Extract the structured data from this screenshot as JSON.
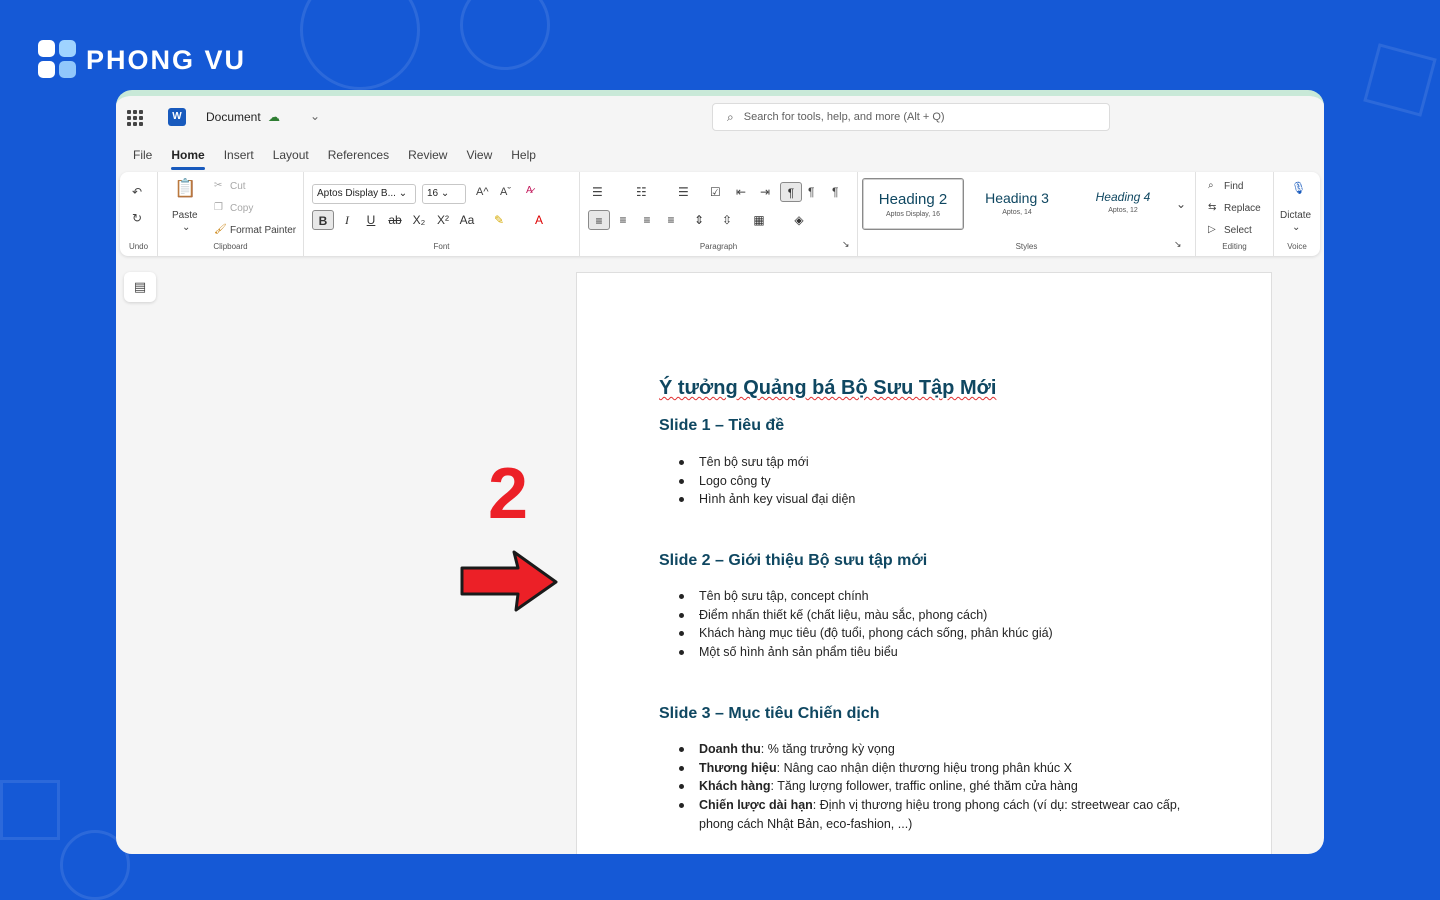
{
  "brand": {
    "name": "PHONG VU"
  },
  "titlebar": {
    "app_icon": "W",
    "document_name": "Document",
    "search_placeholder": "Search for tools, help, and more (Alt + Q)"
  },
  "tabs": [
    "File",
    "Home",
    "Insert",
    "Layout",
    "References",
    "Review",
    "View",
    "Help"
  ],
  "active_tab": "Home",
  "ribbon": {
    "undo": {
      "label": "Undo"
    },
    "clipboard": {
      "label": "Clipboard",
      "paste": "Paste",
      "cut": "Cut",
      "copy": "Copy",
      "format_painter": "Format Painter"
    },
    "font": {
      "label": "Font",
      "family": "Aptos Display B...",
      "size": "16",
      "grow": "A^",
      "shrink": "Aˇ",
      "bold": "B",
      "italic": "I",
      "underline": "U",
      "strike": "ab",
      "subscript": "X₂",
      "superscript": "X²",
      "case": "Aa"
    },
    "paragraph": {
      "label": "Paragraph"
    },
    "styles": {
      "label": "Styles",
      "items": [
        {
          "name": "Heading 2",
          "sub": "Aptos Display, 16"
        },
        {
          "name": "Heading 3",
          "sub": "Aptos, 14"
        },
        {
          "name": "Heading 4",
          "sub": "Aptos, 12"
        }
      ]
    },
    "editing": {
      "label": "Editing",
      "find": "Find",
      "replace": "Replace",
      "select": "Select"
    },
    "voice": {
      "label": "Voice",
      "dictate": "Dictate"
    }
  },
  "document": {
    "title": "Ý tưởng Quảng bá Bộ Sưu Tập Mới",
    "slides": [
      {
        "heading": "Slide 1 – Tiêu đề",
        "bullets": [
          {
            "text": "Tên bộ sưu tập mới"
          },
          {
            "text": "Logo công ty"
          },
          {
            "text": "Hình ảnh key visual đại diện"
          }
        ]
      },
      {
        "heading": "Slide 2 – Giới thiệu Bộ sưu tập mới",
        "bullets": [
          {
            "text": "Tên bộ sưu tập, concept chính"
          },
          {
            "text": "Điểm nhấn thiết kế (chất liệu, màu sắc, phong cách)"
          },
          {
            "text": "Khách hàng mục tiêu (độ tuổi, phong cách sống, phân khúc giá)"
          },
          {
            "text": "Một số hình ảnh sản phẩm tiêu biểu"
          }
        ]
      },
      {
        "heading": "Slide 3 – Mục tiêu Chiến dịch",
        "bullets": [
          {
            "bold": "Doanh thu",
            "text": ": % tăng trưởng kỳ vọng"
          },
          {
            "bold": "Thương hiệu",
            "text": ": Nâng cao nhận diện thương hiệu trong phân khúc X"
          },
          {
            "bold": "Khách hàng",
            "text": ": Tăng lượng follower, traffic online, ghé thăm cửa hàng"
          },
          {
            "bold": "Chiến lược dài hạn",
            "text": ": Định vị thương hiệu trong phong cách (ví dụ: streetwear cao cấp, phong cách Nhật Bản, eco-fashion, ...)"
          }
        ]
      }
    ]
  },
  "annotation": {
    "step_number": "2",
    "arrow_color": "#ec2027"
  },
  "colors": {
    "background": "#1559d6",
    "heading": "#0f4761",
    "accent": "#185abd"
  }
}
